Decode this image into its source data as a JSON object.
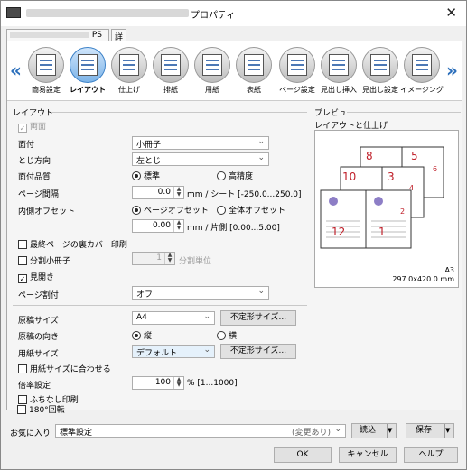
{
  "window": {
    "title_suffix": "プロパティ",
    "close": "✕"
  },
  "tabs": [
    {
      "label": "PS"
    },
    {
      "label": "詳細設定"
    }
  ],
  "iconbar": {
    "items": [
      {
        "label": "簡易設定"
      },
      {
        "label": "レイアウト"
      },
      {
        "label": "仕上げ"
      },
      {
        "label": "排紙"
      },
      {
        "label": "用紙"
      },
      {
        "label": "表紙"
      },
      {
        "label": "ページ設定"
      },
      {
        "label": "見出し挿入"
      },
      {
        "label": "見出し設定"
      },
      {
        "label": "イメージング"
      }
    ],
    "left_arrow": "«",
    "right_arrow": "»"
  },
  "layout": {
    "group_title": "レイアウト",
    "duplex_label": "両面",
    "binding_label": "面付",
    "binding_value": "小冊子",
    "binding_dir_label": "とじ方向",
    "binding_dir_value": "左とじ",
    "quality_label": "面付品質",
    "quality_std": "標準",
    "quality_high": "高精度",
    "gap_label": "ページ間隔",
    "gap_value": "0.0",
    "gap_unit": "mm / シート [-250.0...250.0]",
    "offset_label": "内側オフセット",
    "offset_page": "ページオフセット",
    "offset_all": "全体オフセット",
    "offset_value": "0.00",
    "offset_unit": "mm / 片側 [0.00...5.00]",
    "backcover_label": "最終ページの裏カバー印刷",
    "split_label": "分割小冊子",
    "split_value": "1",
    "split_unit": "分割単位",
    "spread_label": "見開き",
    "pagesplit_label": "ページ割付",
    "pagesplit_value": "オフ",
    "orig_size_label": "原稿サイズ",
    "orig_size_value": "A4",
    "custom_btn": "不定形サイズ...",
    "orient_label": "原稿の向き",
    "orient_portrait": "縦",
    "orient_landscape": "横",
    "paper_size_label": "用紙サイズ",
    "paper_size_value": "デフォルト",
    "custom_btn2": "不定形サイズ...",
    "fit_label": "用紙サイズに合わせる",
    "zoom_label": "倍率設定",
    "zoom_value": "100",
    "zoom_unit": "% [1...1000]",
    "borderless_label": "ふちなし印刷",
    "rotate_label": "180°回転"
  },
  "preview": {
    "group_title": "プレビュー",
    "subtitle": "レイアウトと仕上げ",
    "pages": [
      "8",
      "5",
      "6",
      "10",
      "3",
      "4",
      "12",
      "1",
      "2"
    ],
    "paper": "A3",
    "paper_dim": "297.0x420.0 mm"
  },
  "favorites": {
    "label": "お気に入り",
    "value": "標準設定",
    "changed": "(変更あり)",
    "load": "読込",
    "save": "保存"
  },
  "buttons": {
    "ok": "OK",
    "cancel": "キャンセル",
    "help": "ヘルプ"
  }
}
